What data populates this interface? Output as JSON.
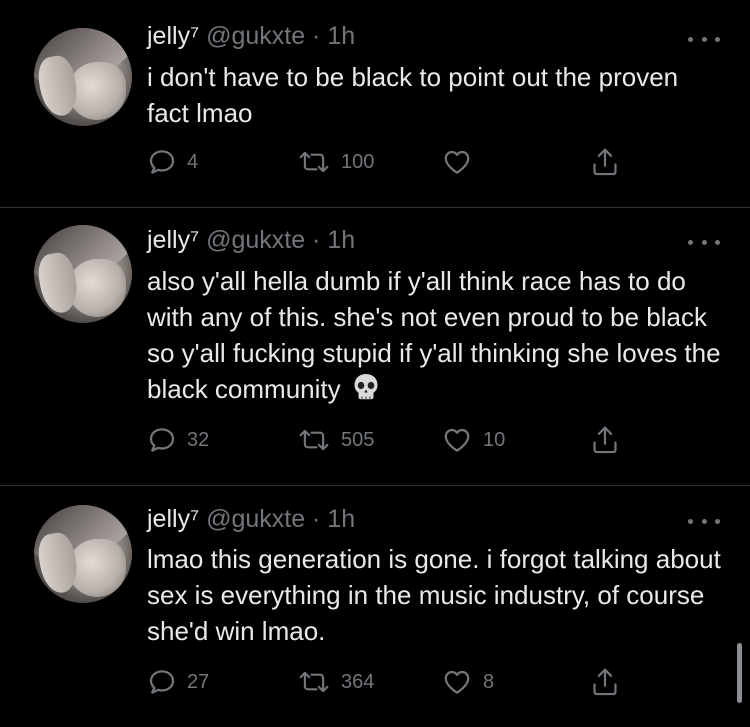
{
  "tweets": [
    {
      "name": "jelly⁷",
      "handle": "@gukxte · 1h",
      "text": "i don't have to be black to point out the proven fact lmao",
      "has_skull": false,
      "replies": "4",
      "retweets": "100",
      "likes": ""
    },
    {
      "name": "jelly⁷",
      "handle": "@gukxte · 1h",
      "text": "also y'all hella dumb if y'all think race has to do with any of this. she's not even proud to be black so y'all fucking stupid if y'all thinking she loves the black community",
      "has_skull": true,
      "replies": "32",
      "retweets": "505",
      "likes": "10"
    },
    {
      "name": "jelly⁷",
      "handle": "@gukxte · 1h",
      "text": "lmao this generation is gone. i forgot talking about sex is everything in the music industry, of course she'd win lmao.",
      "has_skull": false,
      "replies": "27",
      "retweets": "364",
      "likes": "8"
    }
  ],
  "icons": {
    "reply": "reply-icon",
    "retweet": "retweet-icon",
    "like": "heart-icon",
    "share": "share-icon",
    "more": "more-options-icon",
    "emoji": "skull-emoji"
  },
  "colors": {
    "background": "#000000",
    "text": "#e7e9ea",
    "secondary": "#71767b",
    "divider": "#2f3336"
  }
}
